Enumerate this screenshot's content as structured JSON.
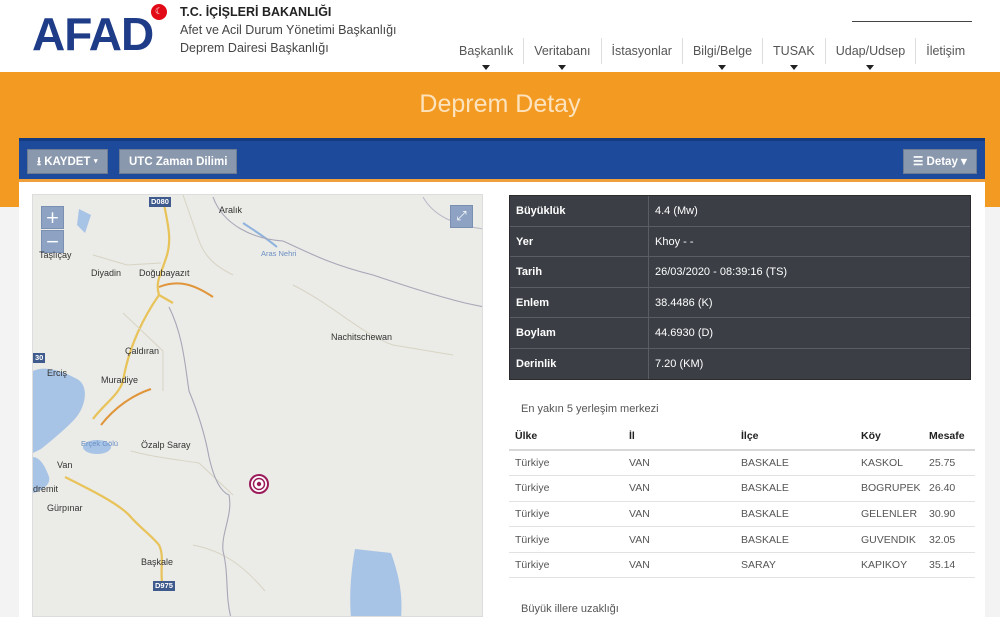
{
  "header": {
    "logo": "AFAD",
    "org_line1": "T.C. İÇİŞLERİ BAKANLIĞI",
    "org_line2": "Afet ve Acil Durum Yönetimi Başkanlığı",
    "org_line3": "Deprem Dairesi Başkanlığı",
    "nav": [
      {
        "label": "Başkanlık",
        "dropdown": true
      },
      {
        "label": "Veritabanı",
        "dropdown": true
      },
      {
        "label": "İstasyonlar",
        "dropdown": false
      },
      {
        "label": "Bilgi/Belge",
        "dropdown": true
      },
      {
        "label": "TUSAK",
        "dropdown": true
      },
      {
        "label": "Udap/Udsep",
        "dropdown": true
      },
      {
        "label": "İletişim",
        "dropdown": false
      }
    ]
  },
  "page_title": "Deprem Detay",
  "toolbar": {
    "save_label": "KAYDET",
    "utc_label": "UTC Zaman Dilimi",
    "detail_label": "Detay"
  },
  "map": {
    "zoom_in": "+",
    "zoom_out": "−",
    "labels": {
      "aralik": "Aralık",
      "aras": "Aras Nehri",
      "tasli": "Taşlıçay",
      "diyadin": "Diyadin",
      "dogubayazit": "Doğubayazıt",
      "nachitschewan": "Nachitschewan",
      "caldiran": "Çaldıran",
      "ercis": "Erciş",
      "muradiye": "Muradiye",
      "ercek": "Erçek Gölü",
      "ozalp": "Özalp Saray",
      "van": "Van",
      "edremit": "dremit",
      "gurpinar": "Gürpınar",
      "baskale": "Başkale",
      "d080": "D080",
      "d975": "D975",
      "r30": "30"
    }
  },
  "details": [
    {
      "label": "Büyüklük",
      "value": "4.4 (Mw)"
    },
    {
      "label": "Yer",
      "value": "Khoy - -"
    },
    {
      "label": "Tarih",
      "value": "26/03/2020 - 08:39:16 (TS)"
    },
    {
      "label": "Enlem",
      "value": "38.4486 (K)"
    },
    {
      "label": "Boylam",
      "value": "44.6930 (D)"
    },
    {
      "label": "Derinlik",
      "value": "7.20 (KM)"
    }
  ],
  "nearest_title": "En yakın 5 yerleşim merkezi",
  "nearest_headers": [
    "Ülke",
    "İl",
    "İlçe",
    "Köy",
    "Mesafe"
  ],
  "nearest_rows": [
    [
      "Türkiye",
      "VAN",
      "BASKALE",
      "KASKOL",
      "25.75"
    ],
    [
      "Türkiye",
      "VAN",
      "BASKALE",
      "BOGRUPEK",
      "26.40"
    ],
    [
      "Türkiye",
      "VAN",
      "BASKALE",
      "GELENLER",
      "30.90"
    ],
    [
      "Türkiye",
      "VAN",
      "BASKALE",
      "GUVENDIK",
      "32.05"
    ],
    [
      "Türkiye",
      "VAN",
      "SARAY",
      "KAPIKOY",
      "35.14"
    ]
  ],
  "far_title": "Büyük illere uzaklığı",
  "colors": {
    "brand_blue": "#1f3c88",
    "accent_orange": "#f29a22",
    "toolbar_blue": "#1e4a9c",
    "epicenter": "#9b1b5a"
  }
}
